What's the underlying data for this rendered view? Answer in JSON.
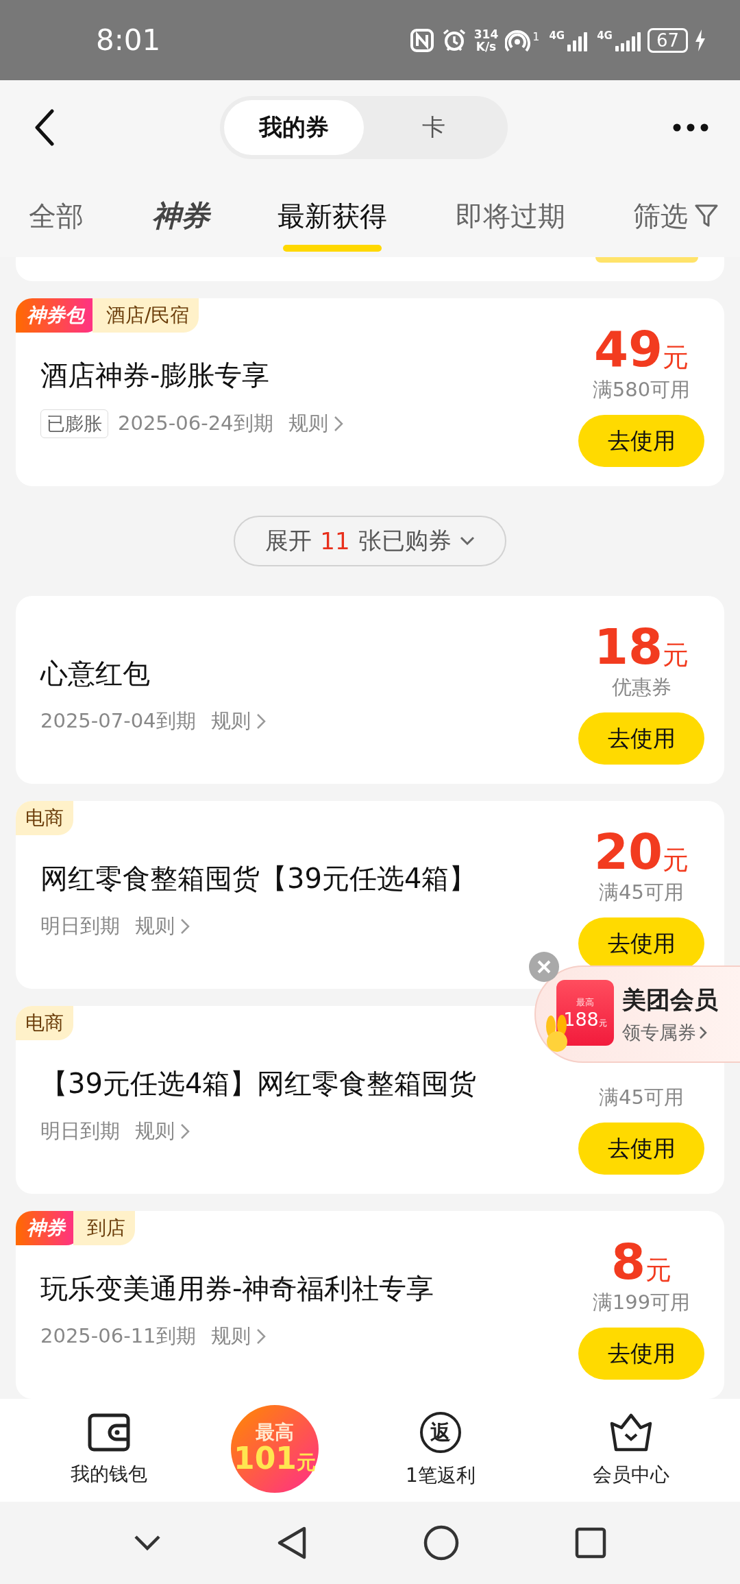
{
  "status_bar": {
    "time": "8:01",
    "net_speed": "314",
    "net_unit": "K/s",
    "hotspot_sub": "1",
    "signal_1": "4G",
    "signal_2": "4G",
    "battery": "67",
    "charging": true
  },
  "header": {
    "segments": [
      {
        "label": "我的券",
        "selected": true
      },
      {
        "label": "卡",
        "selected": false
      }
    ]
  },
  "tabs": [
    {
      "label": "全部",
      "kind": "text",
      "selected": false
    },
    {
      "label": "神券",
      "kind": "logo",
      "selected": false
    },
    {
      "label": "最新获得",
      "kind": "text",
      "selected": true
    },
    {
      "label": "即将过期",
      "kind": "text",
      "selected": false
    },
    {
      "label": "筛选",
      "kind": "filter",
      "selected": false
    }
  ],
  "sections": [
    {
      "kind": "fragment"
    },
    {
      "kind": "card",
      "tags": [
        {
          "label": "神券包",
          "kind": "promo"
        },
        {
          "label": "酒店/民宿",
          "kind": "category"
        }
      ],
      "title": "酒店神券-膨胀专享",
      "badge": "已膨胀",
      "expiry": "2025-06-24到期",
      "rule": "规则",
      "price": "49",
      "unit": "元",
      "condition": "满580可用",
      "action": "去使用"
    },
    {
      "kind": "expand",
      "prefix": "展开",
      "count": "11",
      "suffix": "张已购券"
    },
    {
      "kind": "card",
      "title": "心意红包",
      "expiry": "2025-07-04到期",
      "rule": "规则",
      "price": "18",
      "unit": "元",
      "condition": "优惠券",
      "action": "去使用"
    },
    {
      "kind": "card",
      "tags": [
        {
          "label": "电商",
          "kind": "category"
        }
      ],
      "title": "网红零食整箱囤货【39元任选4箱】",
      "expiry": "明日到期",
      "rule": "规则",
      "price": "20",
      "unit": "元",
      "condition": "满45可用",
      "action": "去使用"
    },
    {
      "kind": "card",
      "tags": [
        {
          "label": "电商",
          "kind": "category"
        }
      ],
      "title": "【39元任选4箱】网红零食整箱囤货",
      "expiry": "明日到期",
      "rule": "规则",
      "condition": "满45可用",
      "action": "去使用"
    },
    {
      "kind": "card",
      "tags": [
        {
          "label": "神券",
          "kind": "promo"
        },
        {
          "label": "到店",
          "kind": "category"
        }
      ],
      "title": "玩乐变美通用券-神奇福利社专享",
      "expiry": "2025-06-11到期",
      "rule": "规则",
      "price": "8",
      "unit": "元",
      "condition": "满199可用",
      "action": "去使用"
    }
  ],
  "member_popup": {
    "small": "最高",
    "amount": "188",
    "unit": "元",
    "title": "美团会员",
    "subtitle": "领专属券"
  },
  "bottom_nav": [
    {
      "kind": "wallet",
      "label": "我的钱包"
    },
    {
      "kind": "promo",
      "top": "最高",
      "amount": "101",
      "unit": "元"
    },
    {
      "kind": "rebate",
      "icon_char": "返",
      "label": "1笔返利"
    },
    {
      "kind": "crown",
      "label": "会员中心"
    }
  ]
}
